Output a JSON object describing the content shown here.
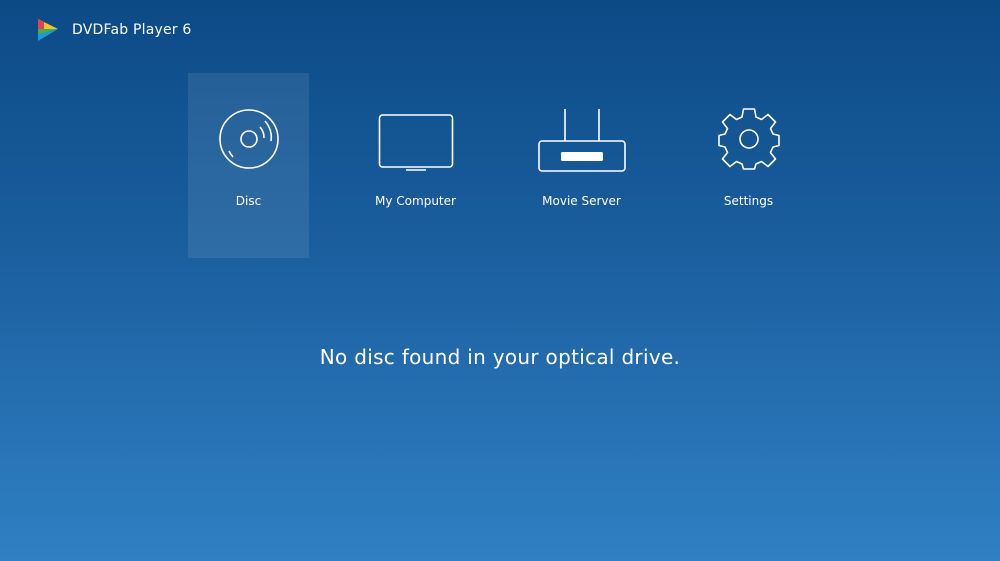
{
  "app": {
    "title": "DVDFab Player 6",
    "logo_icon": "dvdfab-logo-icon"
  },
  "nav": {
    "items": [
      {
        "label": "Disc",
        "icon": "disc-icon",
        "active": true
      },
      {
        "label": "My Computer",
        "icon": "monitor-icon",
        "active": false
      },
      {
        "label": "Movie Server",
        "icon": "router-icon",
        "active": false
      },
      {
        "label": "Settings",
        "icon": "gear-icon",
        "active": false
      }
    ]
  },
  "main": {
    "status_message": "No disc found in your optical drive."
  },
  "colors": {
    "background_top": "#0c4a86",
    "background_bottom": "#3080c4",
    "text": "#ffffff"
  }
}
